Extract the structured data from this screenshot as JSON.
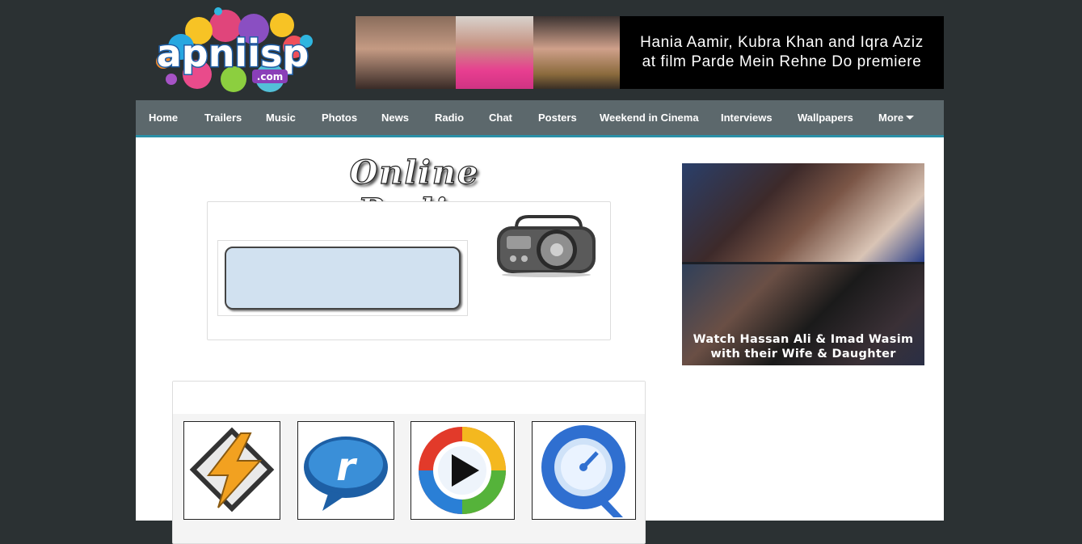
{
  "site": {
    "logo_text": "apniisp",
    "logo_suffix": ".com"
  },
  "banner": {
    "line1": "Hania Aamir, Kubra Khan and Iqra Aziz",
    "line2": "at film Parde Mein Rehne Do premiere"
  },
  "nav": {
    "items": [
      {
        "label": "Home"
      },
      {
        "label": "Trailers"
      },
      {
        "label": "Music"
      },
      {
        "label": "Photos"
      },
      {
        "label": "News"
      },
      {
        "label": "Radio"
      },
      {
        "label": "Chat"
      },
      {
        "label": "Posters"
      },
      {
        "label": "Weekend in Cinema"
      },
      {
        "label": "Interviews"
      },
      {
        "label": "Wallpapers"
      },
      {
        "label": "More"
      }
    ]
  },
  "main": {
    "title": "Online Radio"
  },
  "players": [
    "winamp-icon",
    "realplayer-icon",
    "windows-media-player-icon",
    "quicktime-icon"
  ],
  "side_ad": {
    "line1": "Watch Hassan Ali & Imad Wasim",
    "line2": "with their Wife & Daughter"
  },
  "colors": {
    "page_bg": "#2b3133",
    "nav_bg": "#5c686c",
    "nav_accent": "#2a8fa6",
    "player_screen": "#d1e1f0"
  }
}
